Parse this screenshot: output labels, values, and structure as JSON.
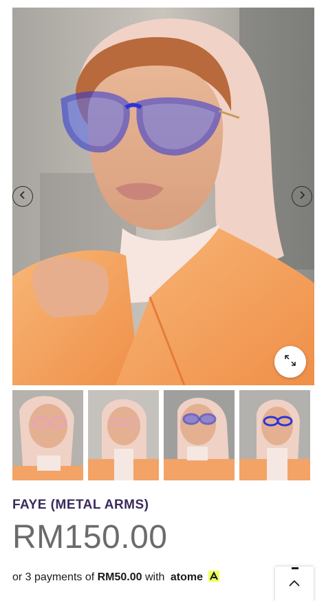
{
  "product": {
    "title": "FAYE (METAL ARMS)",
    "price": "RM150.00"
  },
  "installment": {
    "prefix": "or 3 payments of",
    "amount": "RM50.00",
    "mid": "with",
    "provider": "atome"
  },
  "gallery": {
    "thumbnail_count": 4,
    "icons": [
      "chevron-left-icon",
      "chevron-right-icon",
      "expand-icon",
      "chevron-up-icon"
    ]
  },
  "colors": {
    "title": "#3a2a5c",
    "price": "#6b6b6b",
    "frame_blue": "#2a35d8",
    "jacket_orange": "#f5a05c",
    "atome_badge": "#f0ff5f"
  }
}
